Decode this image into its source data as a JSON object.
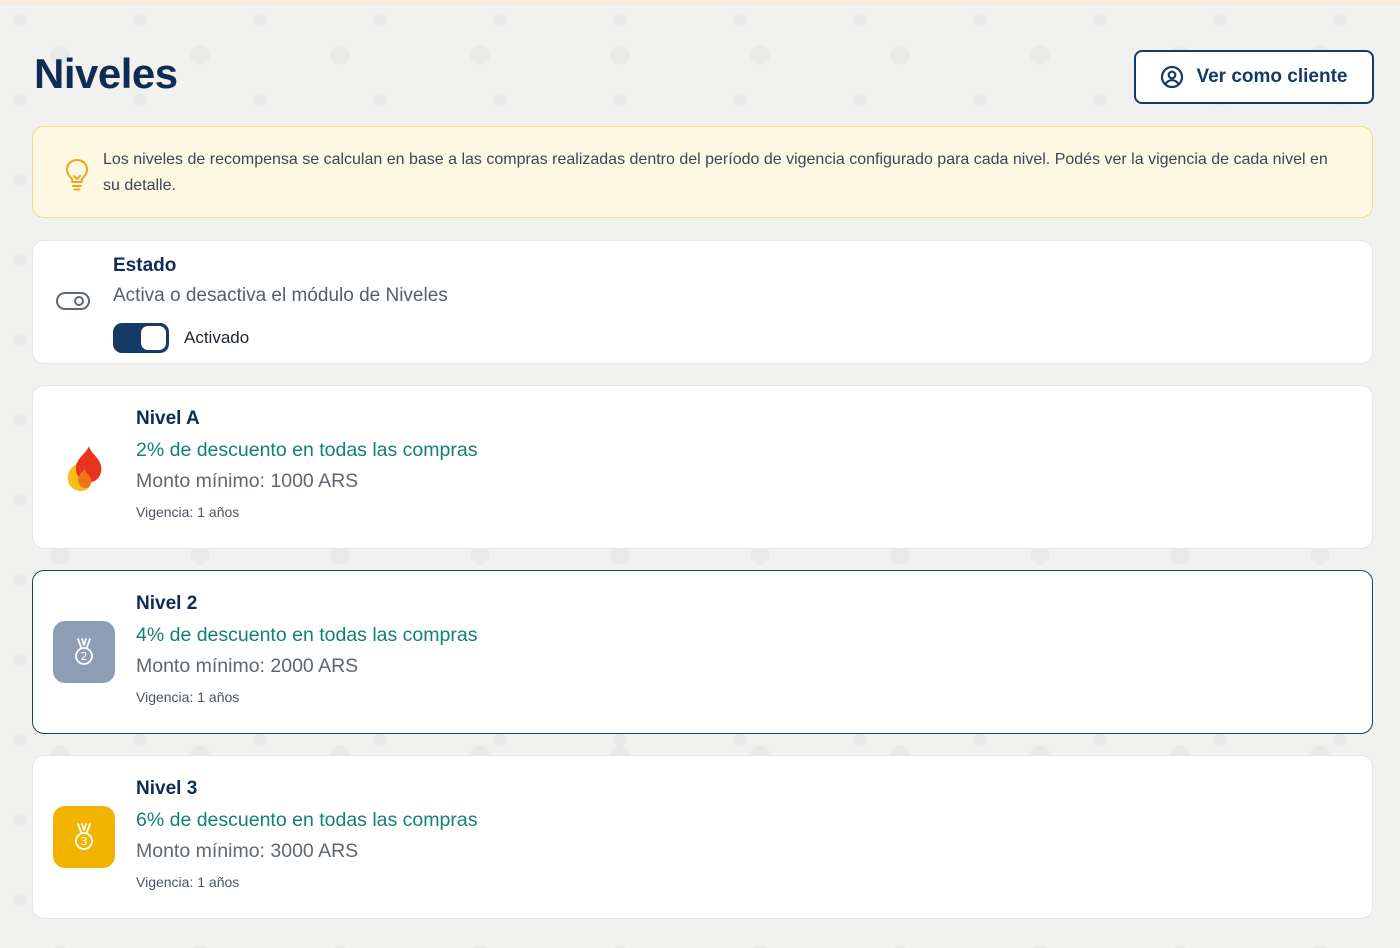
{
  "page": {
    "title": "Niveles",
    "view_as_client_label": "Ver como cliente"
  },
  "info_banner": {
    "text": "Los niveles de recompensa se calculan en base a las compras realizadas dentro del período de vigencia configurado para cada nivel. Podés ver la vigencia de cada nivel en su detalle.",
    "icon": "lightbulb-icon"
  },
  "estado": {
    "title": "Estado",
    "description": "Activa o desactiva el módulo de Niveles",
    "toggle_label": "Activado",
    "enabled": true,
    "icon": "toggle-icon"
  },
  "levels": [
    {
      "name": "Nivel A",
      "benefit": "2% de descuento en todas las compras",
      "minimum": "Monto mínimo: 1000 ARS",
      "validity": "Vigencia: 1 años",
      "icon": "flame-icon",
      "badge_color": "#ffffff",
      "selected": false
    },
    {
      "name": "Nivel 2",
      "benefit": "4% de descuento en todas las compras",
      "minimum": "Monto mínimo: 2000 ARS",
      "validity": "Vigencia: 1 años",
      "icon": "medal-2-icon",
      "badge_color": "#8d9db4",
      "badge_number": "2",
      "selected": true
    },
    {
      "name": "Nivel 3",
      "benefit": "6% de descuento en todas las compras",
      "minimum": "Monto mínimo: 3000 ARS",
      "validity": "Vigencia: 1 años",
      "icon": "medal-3-icon",
      "badge_color": "#f2b400",
      "badge_number": "3",
      "selected": false
    }
  ],
  "colors": {
    "primary": "#163a66",
    "title": "#0f2d52",
    "benefit": "#138172",
    "banner_bg": "#fdf8e2",
    "banner_border": "#f4d98a"
  }
}
